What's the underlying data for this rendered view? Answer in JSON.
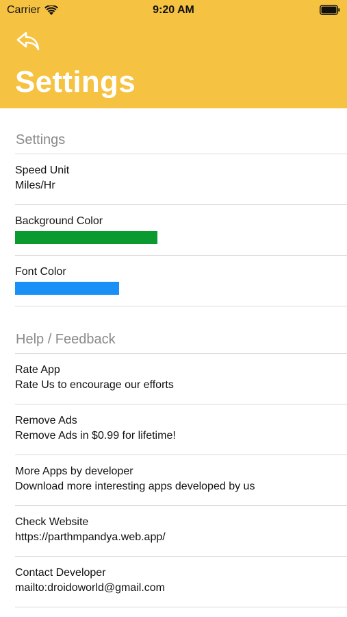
{
  "status_bar": {
    "carrier": "Carrier",
    "time": "9:20 AM",
    "icons": [
      "wifi-icon",
      "battery-icon"
    ]
  },
  "header": {
    "title": "Settings",
    "back_icon": "back-arrow-icon",
    "background_color": "#f5c242"
  },
  "sections": {
    "settings": {
      "header": "Settings",
      "speed_unit": {
        "title": "Speed Unit",
        "value": "Miles/Hr"
      },
      "background_color": {
        "title": "Background Color",
        "color": "#0b9a2f"
      },
      "font_color": {
        "title": "Font Color",
        "color": "#1a8ff6"
      }
    },
    "help": {
      "header": "Help / Feedback",
      "items": [
        {
          "title": "Rate App",
          "subtitle": "Rate Us to encourage our efforts"
        },
        {
          "title": "Remove Ads",
          "subtitle": "Remove Ads in $0.99 for lifetime!"
        },
        {
          "title": "More Apps by developer",
          "subtitle": "Download more interesting apps developed by us"
        },
        {
          "title": "Check Website",
          "subtitle": "https://parthmpandya.web.app/"
        },
        {
          "title": "Contact Developer",
          "subtitle": "mailto:droidoworld@gmail.com"
        }
      ]
    }
  }
}
